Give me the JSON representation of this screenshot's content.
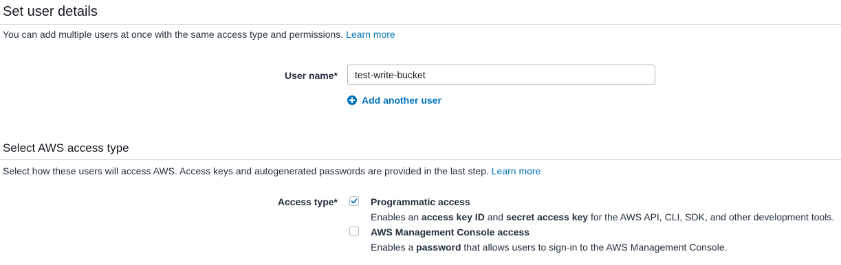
{
  "user_details": {
    "title": "Set user details",
    "description": "You can add multiple users at once with the same access type and permissions.",
    "learn_more": "Learn more",
    "user_name_label": "User name*",
    "user_name_value": "test-write-bucket",
    "add_another_user": "Add another user"
  },
  "access_type": {
    "title": "Select AWS access type",
    "description": "Select how these users will access AWS. Access keys and autogenerated passwords are provided in the last step.",
    "learn_more": "Learn more",
    "label": "Access type*",
    "options": [
      {
        "title": "Programmatic access",
        "checked": true,
        "desc_prefix": "Enables an ",
        "desc_bold1": "access key ID",
        "desc_mid": " and ",
        "desc_bold2": "secret access key",
        "desc_suffix": " for the AWS API, CLI, SDK, and other development tools."
      },
      {
        "title": "AWS Management Console access",
        "checked": false,
        "desc_prefix": "Enables a ",
        "desc_bold1": "password",
        "desc_suffix": " that allows users to sign-in to the AWS Management Console."
      }
    ]
  },
  "colors": {
    "link": "#0073bb",
    "text": "#232f3e",
    "border": "#aab7b8",
    "divider": "#d5dbdb"
  },
  "icons": {
    "add_user": "plus-circle-icon",
    "checkmark": "checkmark-icon"
  }
}
